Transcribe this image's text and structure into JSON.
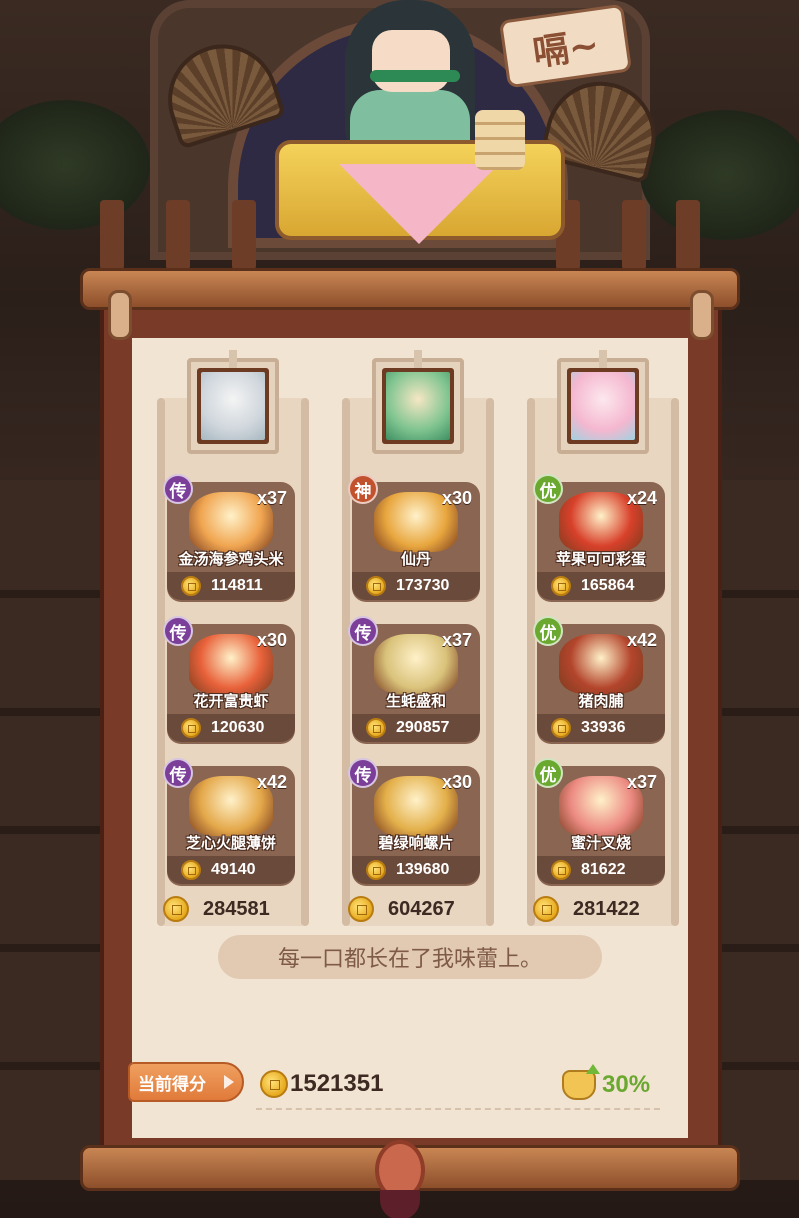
{
  "speech_bubble": "嗝~",
  "colors": {
    "legend_badge": "#7b3f9a",
    "divine_badge": "#c2522e",
    "good_badge": "#6aa830",
    "bonus_green": "#6aa830"
  },
  "columns": [
    {
      "portrait_icon": "white-hair-character",
      "total": "284581",
      "dishes": [
        {
          "badge": "传",
          "tier": "legend",
          "count": "x37",
          "name": "金汤海参鸡头米",
          "price": "114811",
          "color": "#f0a550"
        },
        {
          "badge": "传",
          "tier": "legend",
          "count": "x30",
          "name": "花开富贵虾",
          "price": "120630",
          "color": "#e8613a"
        },
        {
          "badge": "传",
          "tier": "legend",
          "count": "x42",
          "name": "芝心火腿薄饼",
          "price": "49140",
          "color": "#e4a84a"
        }
      ]
    },
    {
      "portrait_icon": "green-hair-character",
      "total": "604267",
      "dishes": [
        {
          "badge": "神",
          "tier": "divine",
          "count": "x30",
          "name": "仙丹",
          "price": "173730",
          "color": "#e8a63e"
        },
        {
          "badge": "传",
          "tier": "legend",
          "count": "x37",
          "name": "生蚝盛和",
          "price": "290857",
          "color": "#d9c27a"
        },
        {
          "badge": "传",
          "tier": "legend",
          "count": "x30",
          "name": "碧绿响螺片",
          "price": "139680",
          "color": "#e3b04a"
        }
      ]
    },
    {
      "portrait_icon": "pink-hair-character",
      "total": "281422",
      "dishes": [
        {
          "badge": "优",
          "tier": "good",
          "count": "x24",
          "name": "苹果可可彩蛋",
          "price": "165864",
          "color": "#d8402a"
        },
        {
          "badge": "优",
          "tier": "good",
          "count": "x42",
          "name": "猪肉脯",
          "price": "33936",
          "color": "#b3452c"
        },
        {
          "badge": "优",
          "tier": "good",
          "count": "x37",
          "name": "蜜汁叉烧",
          "price": "81622",
          "color": "#ec8a82"
        }
      ]
    }
  ],
  "quote": "每一口都长在了我味蕾上。",
  "score_label": "当前得分",
  "score_value": "1521351",
  "bonus_percent": "30%"
}
